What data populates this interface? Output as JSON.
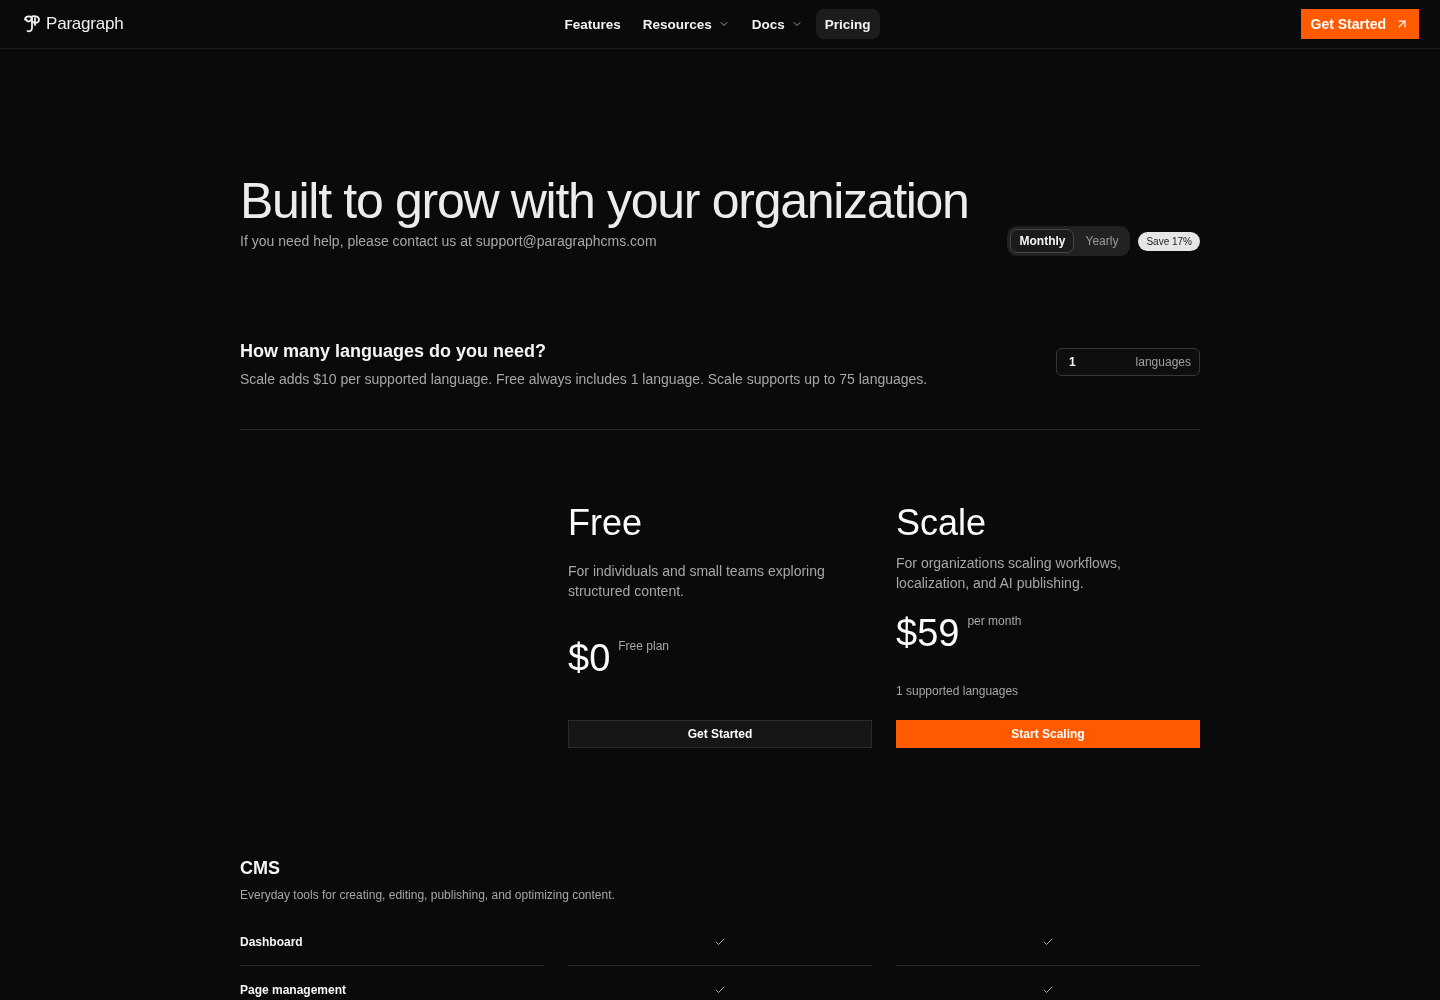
{
  "nav": {
    "brand": "Paragraph",
    "links": [
      {
        "label": "Features",
        "has_menu": false,
        "selected": false
      },
      {
        "label": "Resources",
        "has_menu": true,
        "selected": false
      },
      {
        "label": "Docs",
        "has_menu": true,
        "selected": false
      },
      {
        "label": "Pricing",
        "has_menu": false,
        "selected": true
      }
    ],
    "cta": "Get Started"
  },
  "hero": {
    "title": "Built to grow with your organization",
    "subtitle": "If you need help, please contact us at support@paragraphcms.com",
    "billing": [
      {
        "label": "Monthly",
        "selected": true
      },
      {
        "label": "Yearly",
        "selected": false
      }
    ],
    "badge": "Save 17%"
  },
  "languages": {
    "heading": "How many languages do you need?",
    "description": "Scale adds $10 per supported language. Free always includes 1 language. Scale supports up to 75 languages.",
    "value": "1",
    "suffix": "languages"
  },
  "plans": [
    {
      "name": "Free",
      "description": "For individuals and small teams exploring structured content.",
      "price": "$0",
      "period": "Free plan",
      "button": "Get Started",
      "kind": "secondary"
    },
    {
      "name": "Scale",
      "description": "For organizations scaling workflows, localization, and AI publishing.",
      "price": "$59",
      "period": "per month",
      "note": "1 supported languages",
      "button": "Start Scaling",
      "kind": "primary"
    }
  ],
  "features": {
    "heading": "CMS",
    "description": "Everyday tools for creating, editing, publishing, and optimizing content.",
    "rows": [
      {
        "label": "Dashboard",
        "included": [
          true,
          true
        ]
      },
      {
        "label": "Page management",
        "included": [
          true,
          true
        ]
      }
    ]
  }
}
